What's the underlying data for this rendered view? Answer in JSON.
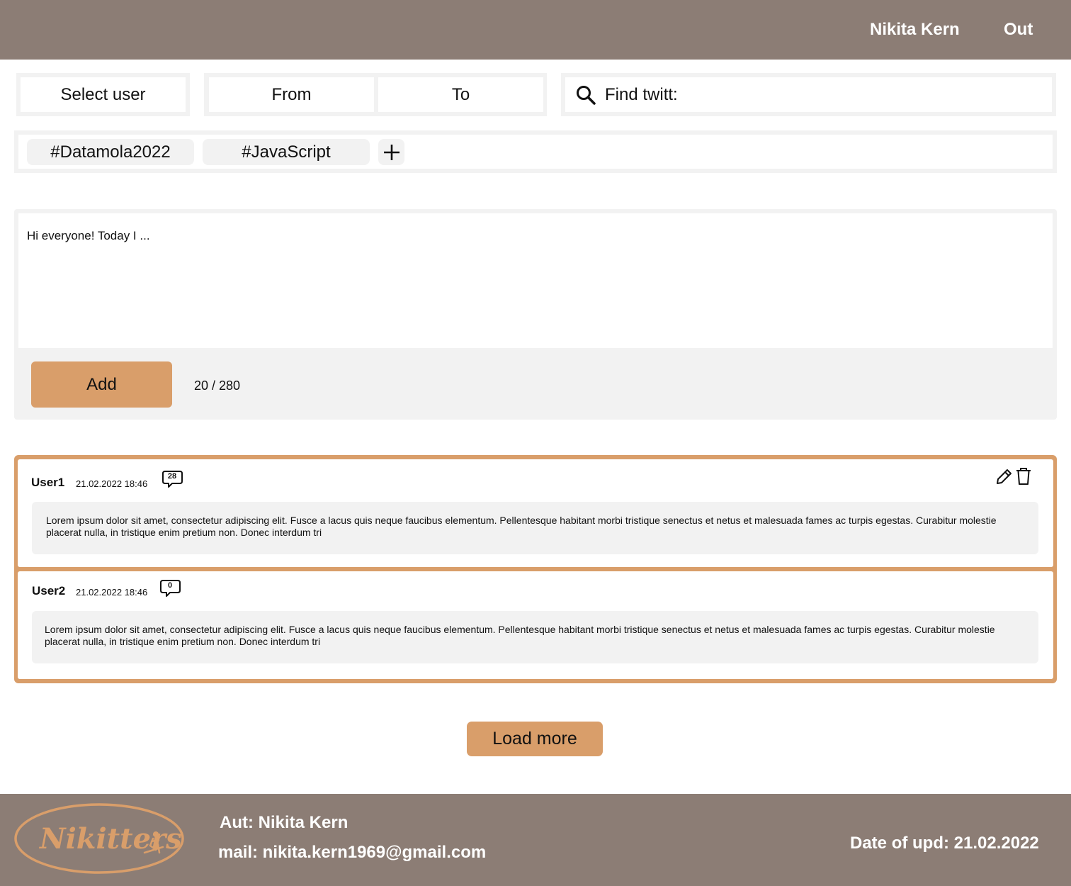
{
  "header": {
    "user_name": "Nikita Kern",
    "logout_label": "Out"
  },
  "filters": {
    "select_user": "Select user",
    "date_from": "From",
    "date_to": "To",
    "search_label": "Find twitt:"
  },
  "tags": [
    {
      "label": "#Datamola2022"
    },
    {
      "label": "#JavaScript"
    }
  ],
  "composer": {
    "text": "Hi everyone! Today I ...",
    "add_label": "Add",
    "char_count": "20 / 280"
  },
  "tweets": [
    {
      "author": "User1",
      "date": "21.02.2022 18:46",
      "comments": "28",
      "text": "Lorem ipsum dolor sit amet, consectetur adipiscing elit. Fusce a lacus quis neque faucibus elementum. Pellentesque habitant morbi tristique senectus et netus et malesuada fames ac turpis egestas. Curabitur molestie placerat nulla, in tristique enim pretium non. Donec interdum tri"
    },
    {
      "author": "User2",
      "date": "21.02.2022 18:46",
      "comments": "0",
      "text": "Lorem ipsum dolor sit amet, consectetur adipiscing elit. Fusce a lacus quis neque faucibus elementum. Pellentesque habitant morbi tristique senectus et netus et malesuada fames ac turpis egestas. Curabitur molestie placerat nulla, in tristique enim pretium non. Donec interdum tri"
    }
  ],
  "load_more_label": "Load more",
  "footer": {
    "logo_text": "Nikitters",
    "author": "Aut: Nikita Kern",
    "mail": "mail: nikita.kern1969@gmail.com",
    "update_date": "Date of upd: 21.02.2022"
  },
  "colors": {
    "header_bg": "#8c7d75",
    "accent": "#d99e6a",
    "panel_bg": "#f2f2f2"
  },
  "icons": [
    "search-icon",
    "plus-icon",
    "comment-icon",
    "edit-icon",
    "trash-icon",
    "skier-icon"
  ]
}
